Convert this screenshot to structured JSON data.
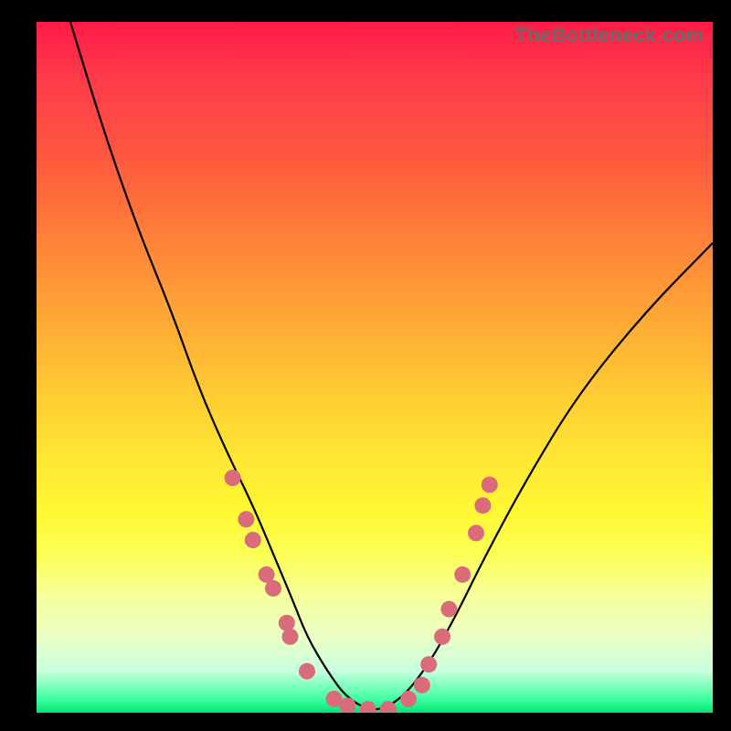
{
  "watermark": "TheBottleneck.com",
  "colors": {
    "background": "#000000",
    "gradient_top": "#ff1a45",
    "gradient_mid": "#ffe933",
    "gradient_bottom": "#00e676",
    "curve": "#000000",
    "dots": "#d96b7a"
  },
  "chart_data": {
    "type": "line",
    "title": "",
    "xlabel": "",
    "ylabel": "",
    "xlim": [
      0,
      100
    ],
    "ylim": [
      0,
      100
    ],
    "note": "No axis ticks or numeric labels are visible; values are plot-fraction estimates (0–100) read from pixel positions.",
    "series": [
      {
        "name": "curve",
        "x": [
          5,
          10,
          15,
          20,
          24,
          28,
          32,
          35,
          38,
          40,
          43,
          46,
          50,
          54,
          58,
          62,
          66,
          72,
          80,
          90,
          100
        ],
        "y": [
          100,
          84,
          70,
          58,
          47,
          38,
          30,
          23,
          16,
          11,
          6,
          2,
          0,
          2,
          7,
          14,
          22,
          33,
          46,
          58,
          68
        ]
      }
    ],
    "highlight_points": {
      "name": "dots",
      "comment": "Pink circular markers clustered near the valley on both branches.",
      "points": [
        {
          "x": 29,
          "y": 34
        },
        {
          "x": 31,
          "y": 28
        },
        {
          "x": 32,
          "y": 25
        },
        {
          "x": 34,
          "y": 20
        },
        {
          "x": 35,
          "y": 18
        },
        {
          "x": 37,
          "y": 13
        },
        {
          "x": 37.5,
          "y": 11
        },
        {
          "x": 40,
          "y": 6
        },
        {
          "x": 44,
          "y": 2
        },
        {
          "x": 46,
          "y": 1
        },
        {
          "x": 49,
          "y": 0.5
        },
        {
          "x": 52,
          "y": 0.5
        },
        {
          "x": 55,
          "y": 2
        },
        {
          "x": 57,
          "y": 4
        },
        {
          "x": 58,
          "y": 7
        },
        {
          "x": 60,
          "y": 11
        },
        {
          "x": 61,
          "y": 15
        },
        {
          "x": 63,
          "y": 20
        },
        {
          "x": 65,
          "y": 26
        },
        {
          "x": 66,
          "y": 30
        },
        {
          "x": 67,
          "y": 33
        }
      ]
    }
  }
}
